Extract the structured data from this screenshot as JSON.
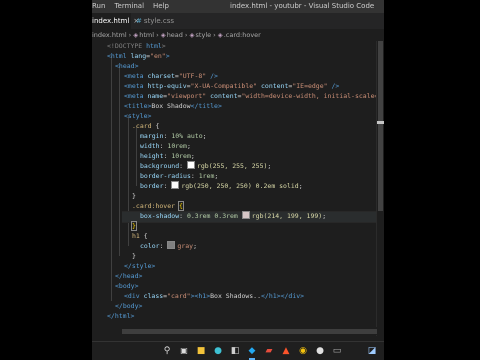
{
  "titlebar": {
    "menu": [
      "Run",
      "Terminal",
      "Help"
    ],
    "title": "index.html - youtubr - Visual Studio Code"
  },
  "tabs": {
    "active": "index.html",
    "inactive": "style.css",
    "close_glyph": "×"
  },
  "breadcrumb": [
    "index.html",
    "html",
    "head",
    "style",
    ".card:hover"
  ],
  "code": {
    "doctype_open": "<!DOCTYPE ",
    "doctype_kw": "html",
    "doctype_close": ">",
    "html_open": "<html ",
    "lang_attr": "lang",
    "lang_val": "\"en\"",
    "head_open": "<head>",
    "meta1": {
      "tag": "<meta ",
      "attr": "charset",
      "val": "\"UTF-8\"",
      "end": " />"
    },
    "meta2": {
      "tag": "<meta ",
      "attr1": "http-equiv",
      "val1": "\"X-UA-Compatible\"",
      "attr2": "content",
      "val2": "\"IE=edge\"",
      "end": " />"
    },
    "meta3": {
      "tag": "<meta ",
      "attr1": "name",
      "val1": "\"viewport\"",
      "attr2": "content",
      "val2": "\"width=device-width, initial-scale=1.0\""
    },
    "title_open": "<title>",
    "title_text": "Box Shadow",
    "title_close": "</title>",
    "style_open": "<style>",
    "card_sel": ".card",
    "margin_prop": "margin",
    "margin_val": "10% auto",
    "width_prop": "width",
    "width_val": "10rem",
    "height_prop": "height",
    "height_val": "10rem",
    "bg_prop": "background",
    "bg_val": "rgb(255, 255, 255)",
    "bg_swatch": "#ffffff",
    "radius_prop": "border-radius",
    "radius_val": "1rem",
    "border_prop": "border",
    "border_val": "rgb(250, 250, 250) 0.2em solid",
    "border_swatch": "#fafafa",
    "hover_sel": ".card:hover",
    "shadow_prop": "box-shadow",
    "shadow_nums": "0.3rem 0.3rem",
    "shadow_val": "rgb(214, 199, 199)",
    "shadow_swatch": "#d6c7c7",
    "h1_sel": "h1",
    "color_prop": "color",
    "color_val": "gray",
    "color_swatch": "#808080",
    "style_close": "</style>",
    "head_close": "</head>",
    "body_open": "<body>",
    "div_open": "<div ",
    "class_attr": "class",
    "class_val": "\"card\"",
    "h1_open": "<h1>",
    "h1_text": "Box Shadows..",
    "h1_close": "</h1>",
    "div_close": "</div>",
    "body_close": "</body>",
    "html_close": "</html>"
  },
  "taskbar": {
    "icons": [
      "search-icon",
      "task-view-icon",
      "file-explorer-icon",
      "edge-icon",
      "store-icon",
      "vscode-icon",
      "office-icon",
      "brave-icon",
      "chrome-icon",
      "github-icon",
      "terminal-icon",
      "app-icon"
    ]
  }
}
